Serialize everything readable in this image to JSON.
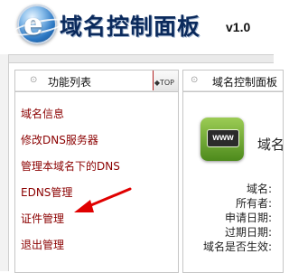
{
  "header": {
    "title": "域名控制面板",
    "version": "v1.0",
    "logo_icon": "globe-e-logo-icon"
  },
  "left_panel": {
    "tab_label": "功能列表",
    "top_link": "TOP",
    "menu_items": [
      {
        "label": "域名信息"
      },
      {
        "label": "修改DNS服务器"
      },
      {
        "label": "管理本域名下的DNS"
      },
      {
        "label": "EDNS管理"
      },
      {
        "label": "证件管理"
      },
      {
        "label": "退出管理"
      }
    ],
    "link_color": "#8b0000"
  },
  "annotation": {
    "arrow_color": "#e00000",
    "arrow_icon": "red-arrow-annotation"
  },
  "right_panel": {
    "tab_label": "域名控制面板",
    "heading": "域名",
    "icon_text": "www",
    "info_labels": [
      "域名:",
      "所有者:",
      "申请日期:",
      "过期日期:",
      "域名是否生效:"
    ]
  },
  "colors": {
    "title": "#0b2a5c",
    "tab_border": "#b22222",
    "www_icon_green": "#6aa82e"
  }
}
